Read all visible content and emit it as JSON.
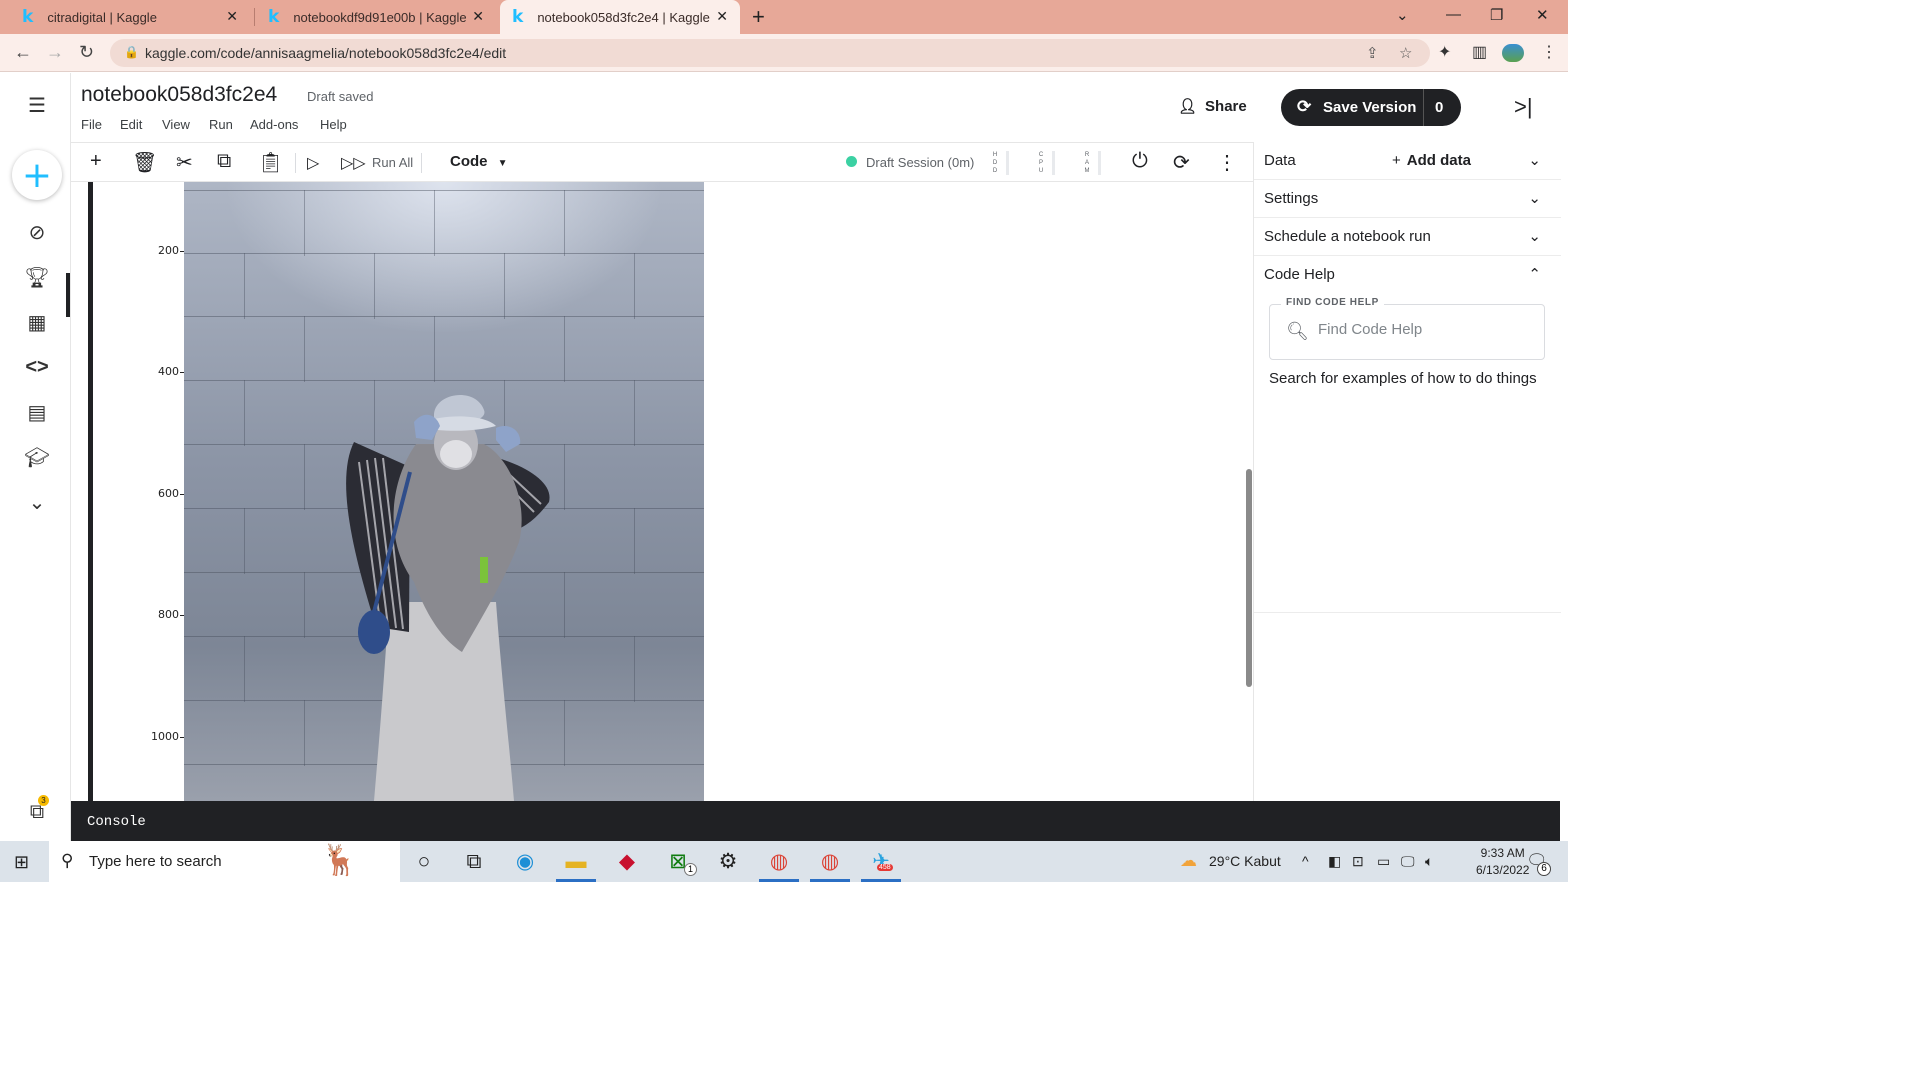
{
  "browser": {
    "tabs": [
      {
        "title": "citradigital | Kaggle"
      },
      {
        "title": "notebookdf9d91e00b | Kaggle"
      },
      {
        "title": "notebook058d3fc2e4 | Kaggle"
      }
    ],
    "url": "kaggle.com/code/annisaagmelia/notebook058d3fc2e4/edit"
  },
  "notebook": {
    "title": "notebook058d3fc2e4",
    "status": "Draft saved",
    "menu": [
      "File",
      "Edit",
      "View",
      "Run",
      "Add-ons",
      "Help"
    ],
    "share_label": "Share",
    "save_version_label": "Save Version",
    "save_version_count": "0"
  },
  "toolbar": {
    "run_all_label": "Run All",
    "cell_type": "Code",
    "session_status": "Draft Session (0m)",
    "meters": [
      "HDD",
      "CPU",
      "RAM"
    ]
  },
  "leftrail": {
    "notification_count": "3"
  },
  "output": {
    "y_ticks": [
      "200",
      "400",
      "600",
      "800",
      "1000"
    ]
  },
  "right_panel": {
    "sections": [
      "Data",
      "Settings",
      "Schedule a notebook run",
      "Code Help"
    ],
    "add_data_label": "Add data",
    "code_help_legend": "FIND CODE HELP",
    "code_help_placeholder": "Find Code Help",
    "code_help_text": "Search for examples of how to do things"
  },
  "console": {
    "label": "Console"
  },
  "taskbar": {
    "search_placeholder": "Type here to search",
    "weather": "29°C  Kabut",
    "time": "9:33 AM",
    "date": "6/13/2022",
    "telegram_badge": "458",
    "xbox_badge": "1",
    "notification_count": "6"
  },
  "colors": {
    "kaggle_blue": "#20beff",
    "session_green": "#3bd1a3",
    "dark": "#202124",
    "browser_frame": "#e7a898"
  }
}
